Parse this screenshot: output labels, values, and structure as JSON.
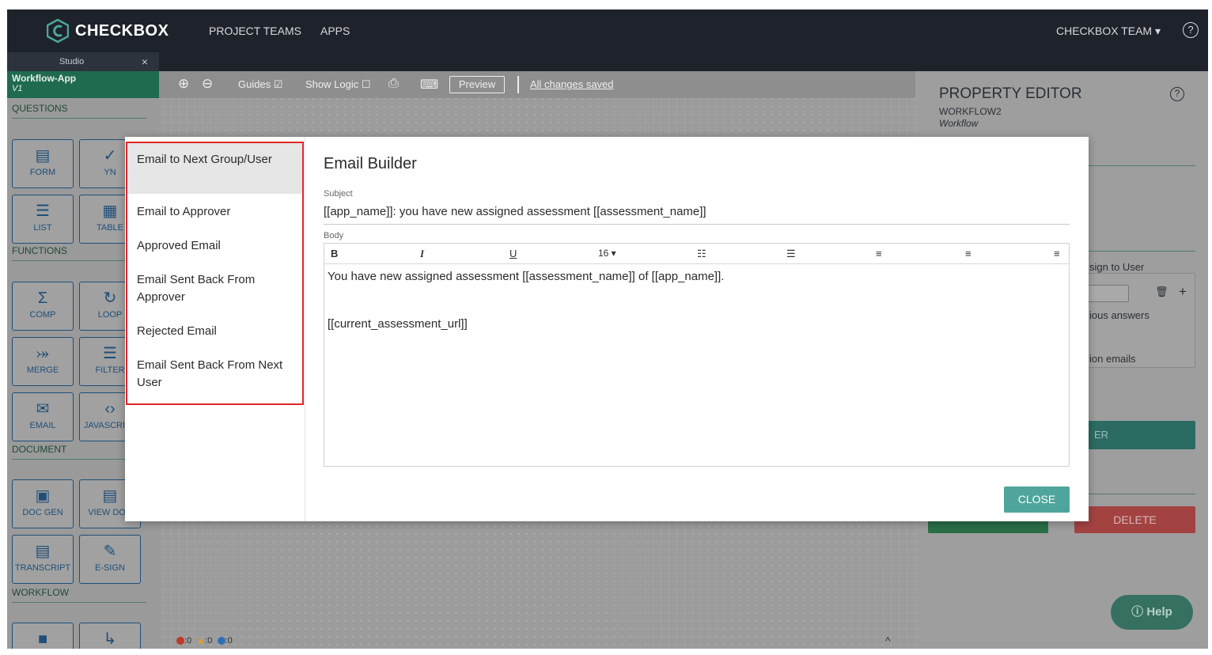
{
  "topnav": {
    "logo_text": "CHECKBOX",
    "links": [
      "PROJECT TEAMS",
      "APPS"
    ],
    "team": "CHECKBOX TEAM",
    "help": "?"
  },
  "studio_tab": {
    "label": "Studio",
    "close": "×"
  },
  "workflow": {
    "name": "Workflow-App",
    "version": "V1"
  },
  "sidebar": {
    "sections": [
      "QUESTIONS",
      "FUNCTIONS",
      "DOCUMENT",
      "WORKFLOW"
    ],
    "tools": [
      {
        "label": "FORM",
        "icon": "▤"
      },
      {
        "label": "YN",
        "icon": "✓"
      },
      {
        "label": "LIST",
        "icon": "☰"
      },
      {
        "label": "TABLE",
        "icon": "▦"
      },
      {
        "label": "COMP",
        "icon": "Σ"
      },
      {
        "label": "LOOP",
        "icon": "↻"
      },
      {
        "label": "MERGE",
        "icon": "⤖"
      },
      {
        "label": "FILTER",
        "icon": "☰"
      },
      {
        "label": "EMAIL",
        "icon": "✉"
      },
      {
        "label": "JAVASCRIPT",
        "icon": "‹›"
      },
      {
        "label": "DOC GEN",
        "icon": "▣"
      },
      {
        "label": "VIEW DOC",
        "icon": "▤"
      },
      {
        "label": "TRANSCRIPT",
        "icon": "▤"
      },
      {
        "label": "E-SIGN",
        "icon": "✎"
      },
      {
        "label": "",
        "icon": "■"
      },
      {
        "label": "",
        "icon": "↳"
      }
    ]
  },
  "toolbar": {
    "zoom_in": "⊕",
    "zoom_out": "⊖",
    "guides": "Guides ☑",
    "show_logic": "Show Logic ☐",
    "print": "⎙",
    "keyboard": "⌨",
    "preview": "Preview",
    "saved": "All changes saved"
  },
  "status": {
    "errors": ":0",
    "warnings": ":0",
    "info": ":0",
    "warn_icon": "▲",
    "caret": "^"
  },
  "property_editor": {
    "title": "PROPERTY EDITOR",
    "help": "?",
    "subtitle": "WORKFLOW2",
    "type": "Workflow",
    "assign": "sign to User",
    "prev_answers": "ious answers",
    "emails": "ion emails",
    "green_btn": "ER",
    "delete": "DELETE",
    "trash": "🗑",
    "plus": "+"
  },
  "help_button": "ⓘ Help",
  "email_builder": {
    "list": [
      "Email to Next Group/User",
      "Email to Approver",
      "Approved Email",
      "Email Sent Back From Approver",
      "Rejected Email",
      "Email Sent Back From Next User"
    ],
    "title": "Email Builder",
    "subject_label": "Subject",
    "subject": "[[app_name]]: you have new assigned assessment [[assessment_name]]",
    "body_label": "Body",
    "toolbar": [
      "B",
      "I",
      "U",
      "16 ▾",
      "☷",
      "☰",
      "≡",
      "≡",
      "≡"
    ],
    "body_line1": "You have new assigned assessment [[assessment_name]] of [[app_name]].",
    "body_line2": "[[current_assessment_url]]",
    "close": "CLOSE"
  },
  "colors": {
    "nav": "#1e232b",
    "accent": "#4fa59b",
    "highlight": "#e0262a"
  }
}
